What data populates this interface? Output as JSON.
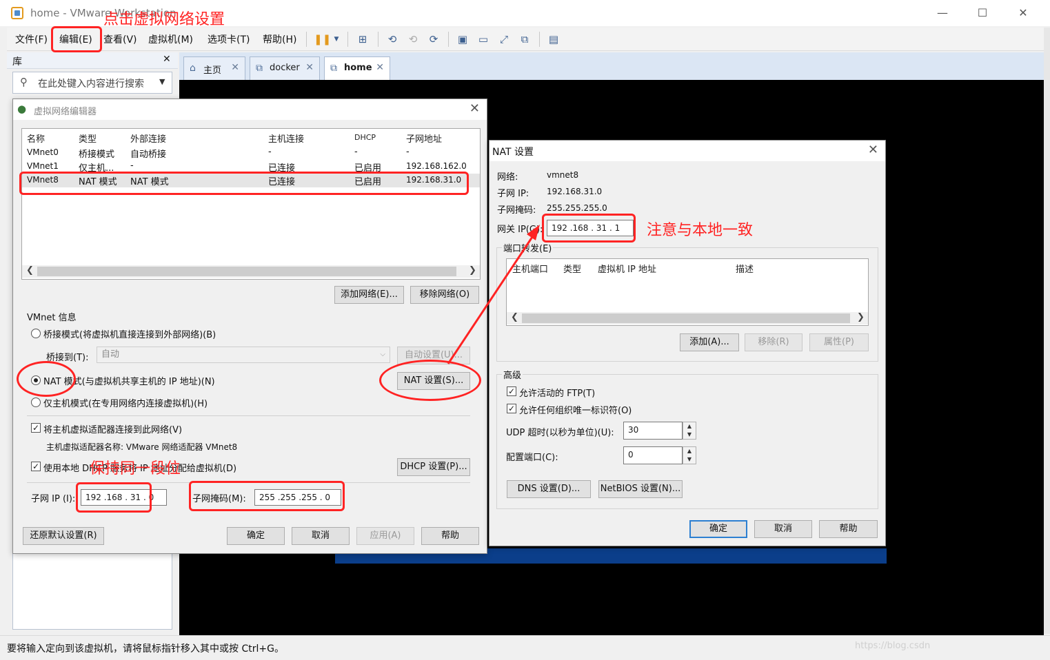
{
  "window": {
    "title": "home - VMware Workstation",
    "minimize": "—",
    "maximize": "☐",
    "close": "✕"
  },
  "menubar": {
    "items": [
      "文件(F)",
      "编辑(E)",
      "查看(V)",
      "虚拟机(M)",
      "选项卡(T)",
      "帮助(H)"
    ]
  },
  "library": {
    "title": "库",
    "close": "✕",
    "search_placeholder": "在此处键入内容进行搜索"
  },
  "tabs": [
    {
      "label": "主页",
      "icon": "home-icon"
    },
    {
      "label": "docker",
      "icon": "vm-icon"
    },
    {
      "label": "home",
      "icon": "vm-icon",
      "active": true
    }
  ],
  "status": {
    "text": "要将输入定向到该虚拟机，请将鼠标指针移入其中或按 Ctrl+G。",
    "watermark": "https://blog.csdn"
  },
  "vne": {
    "title": "虚拟网络编辑器",
    "columns": [
      "名称",
      "类型",
      "外部连接",
      "主机连接",
      "DHCP",
      "子网地址"
    ],
    "rows": [
      [
        "VMnet0",
        "桥接模式",
        "自动桥接",
        "-",
        "-",
        "-"
      ],
      [
        "VMnet1",
        "仅主机...",
        "-",
        "已连接",
        "已启用",
        "192.168.162.0"
      ],
      [
        "VMnet8",
        "NAT 模式",
        "NAT 模式",
        "已连接",
        "已启用",
        "192.168.31.0"
      ]
    ],
    "add_network": "添加网络(E)...",
    "remove_network": "移除网络(O)",
    "info_title": "VMnet 信息",
    "bridge_mode": "桥接模式(将虚拟机直接连接到外部网络)(B)",
    "bridge_to_label": "桥接到(T):",
    "bridge_to_value": "自动",
    "auto_settings": "自动设置(U)...",
    "nat_mode": "NAT 模式(与虚拟机共享主机的 IP 地址)(N)",
    "nat_settings": "NAT 设置(S)...",
    "host_only": "仅主机模式(在专用网络内连接虚拟机)(H)",
    "connect_adapter": "将主机虚拟适配器连接到此网络(V)",
    "adapter_name": "主机虚拟适配器名称: VMware 网络适配器 VMnet8",
    "use_dhcp": "使用本地 DHCP 服务将 IP 地址分配给虚拟机(D)",
    "dhcp_settings": "DHCP 设置(P)...",
    "subnet_ip_label": "子网 IP (I):",
    "subnet_ip": "192 .168 . 31  .  0",
    "subnet_mask_label": "子网掩码(M):",
    "subnet_mask": "255 .255 .255 .  0",
    "restore_defaults": "还原默认设置(R)",
    "ok": "确定",
    "cancel": "取消",
    "apply": "应用(A)",
    "help": "帮助"
  },
  "nat": {
    "title": "NAT 设置",
    "network_label": "网络:",
    "network_value": "vmnet8",
    "subnet_ip_label": "子网 IP:",
    "subnet_ip_value": "192.168.31.0",
    "subnet_mask_label": "子网掩码:",
    "subnet_mask_value": "255.255.255.0",
    "gateway_label": "网关 IP(G):",
    "gateway_value": "192 .168 . 31  .  1",
    "port_forward_title": "端口转发(E)",
    "pf_columns": [
      "主机端口",
      "类型",
      "虚拟机 IP 地址",
      "描述"
    ],
    "add": "添加(A)...",
    "remove": "移除(R)",
    "properties": "属性(P)",
    "advanced_title": "高级",
    "allow_ftp": "允许活动的 FTP(T)",
    "allow_oui": "允许任何组织唯一标识符(O)",
    "udp_timeout_label": "UDP 超时(以秒为单位)(U):",
    "udp_timeout_value": "30",
    "config_port_label": "配置端口(C):",
    "config_port_value": "0",
    "dns": "DNS 设置(D)...",
    "netbios": "NetBIOS 设置(N)...",
    "ok": "确定",
    "cancel": "取消",
    "help": "帮助"
  },
  "annotations": {
    "click_vnet": "点击虚拟网络设置",
    "keep_same_segment": "保持同一段位",
    "match_local": "注意与本地一致",
    "color": "#ff2323"
  }
}
